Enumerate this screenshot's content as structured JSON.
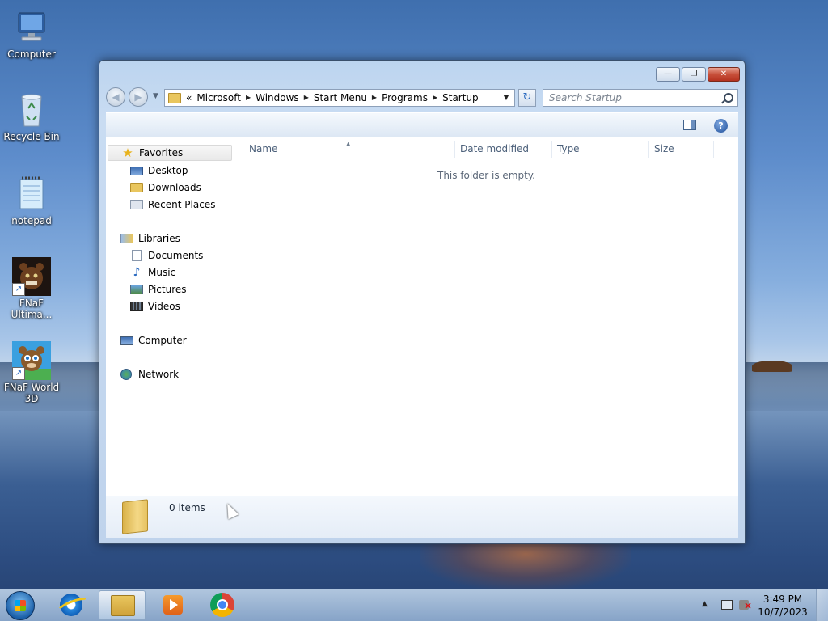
{
  "desktop": {
    "icons": [
      {
        "label": "Computer",
        "icon": "computer-icon"
      },
      {
        "label": "Recycle Bin",
        "icon": "recycle-bin-icon"
      },
      {
        "label": "notepad",
        "icon": "notepad-icon"
      },
      {
        "label": "FNaF Ultima...",
        "icon": "fnaf-ultimate-icon"
      },
      {
        "label": "FNaF World 3D",
        "icon": "fnaf-world-icon"
      }
    ]
  },
  "window": {
    "caption": {
      "minimize_glyph": "—",
      "maximize_glyph": "❐",
      "close_glyph": "✕"
    },
    "address": {
      "overflow": "«",
      "crumbs": [
        "Microsoft",
        "Windows",
        "Start Menu",
        "Programs",
        "Startup"
      ],
      "sep": "▶",
      "drop": "▼"
    },
    "nav": {
      "back": "◀",
      "forward": "▶",
      "drop": "▼"
    },
    "refresh_glyph": "↻",
    "search": {
      "placeholder": "Search Startup"
    },
    "help_glyph": "?",
    "navpane": {
      "favorites": "Favorites",
      "desktop": "Desktop",
      "downloads": "Downloads",
      "recent": "Recent Places",
      "libraries": "Libraries",
      "documents": "Documents",
      "music": "Music",
      "pictures": "Pictures",
      "videos": "Videos",
      "computer": "Computer",
      "network": "Network"
    },
    "columns": {
      "name": "Name",
      "date": "Date modified",
      "type": "Type",
      "size": "Size",
      "sort_glyph": "▲"
    },
    "empty_message": "This folder is empty.",
    "details": {
      "item_count": "0 items"
    }
  },
  "taskbar": {
    "clock_time": "3:49 PM",
    "clock_date": "10/7/2023",
    "tray_arrow": "▲",
    "apps": [
      "internet-explorer-icon",
      "windows-explorer-icon",
      "media-player-icon",
      "chrome-icon"
    ]
  },
  "colors": {
    "window_frame": "#bcd4ef",
    "close_red": "#c7503a",
    "accent_blue": "#2a6ac0"
  }
}
